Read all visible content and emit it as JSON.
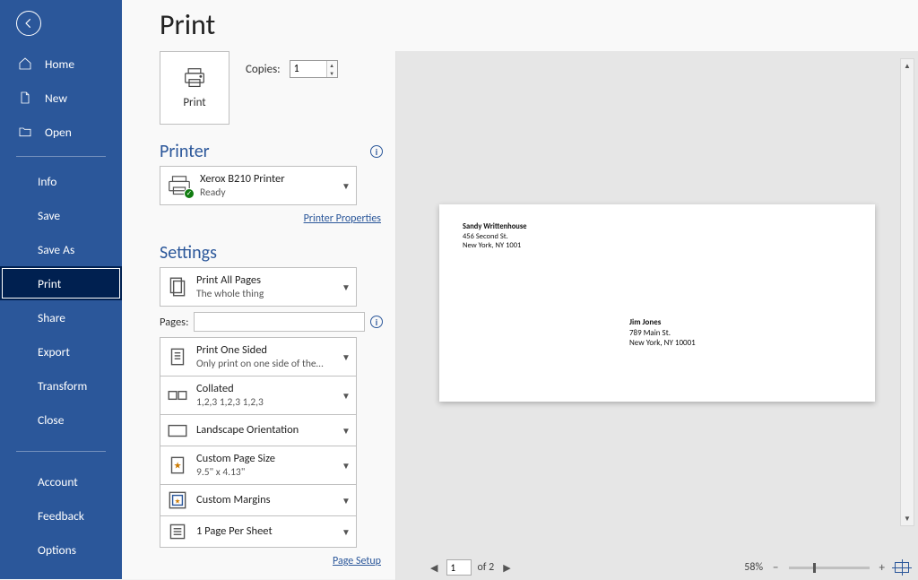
{
  "title": "Print",
  "sidebar": {
    "home": "Home",
    "new": "New",
    "open": "Open",
    "info": "Info",
    "save": "Save",
    "save_as": "Save As",
    "print": "Print",
    "share": "Share",
    "export": "Export",
    "transform": "Transform",
    "close": "Close",
    "account": "Account",
    "feedback": "Feedback",
    "options": "Options"
  },
  "print_button": "Print",
  "copies": {
    "label": "Copies:",
    "value": "1"
  },
  "printer": {
    "heading": "Printer",
    "name": "Xerox B210 Printer",
    "status": "Ready",
    "properties_link": "Printer Properties"
  },
  "settings": {
    "heading": "Settings",
    "what": {
      "t1": "Print All Pages",
      "t2": "The whole thing"
    },
    "pages_label": "Pages:",
    "sides": {
      "t1": "Print One Sided",
      "t2": "Only print on one side of the…"
    },
    "collate": {
      "t1": "Collated",
      "t2": "1,2,3    1,2,3    1,2,3"
    },
    "orientation": {
      "t1": "Landscape Orientation"
    },
    "size": {
      "t1": "Custom Page Size",
      "t2": "9.5\" x 4.13\""
    },
    "margins": {
      "t1": "Custom Margins"
    },
    "ppsheet": {
      "t1": "1 Page Per Sheet"
    },
    "page_setup_link": "Page Setup"
  },
  "preview": {
    "return": {
      "l1": "Sandy Writtenhouse",
      "l2": "456 Second St.",
      "l3": "New York, NY 1001"
    },
    "to": {
      "l1": "Jim Jones",
      "l2": "789 Main St.",
      "l3": "New York, NY 10001"
    }
  },
  "pager": {
    "current": "1",
    "of_label": "of 2",
    "zoom_label": "58%"
  }
}
